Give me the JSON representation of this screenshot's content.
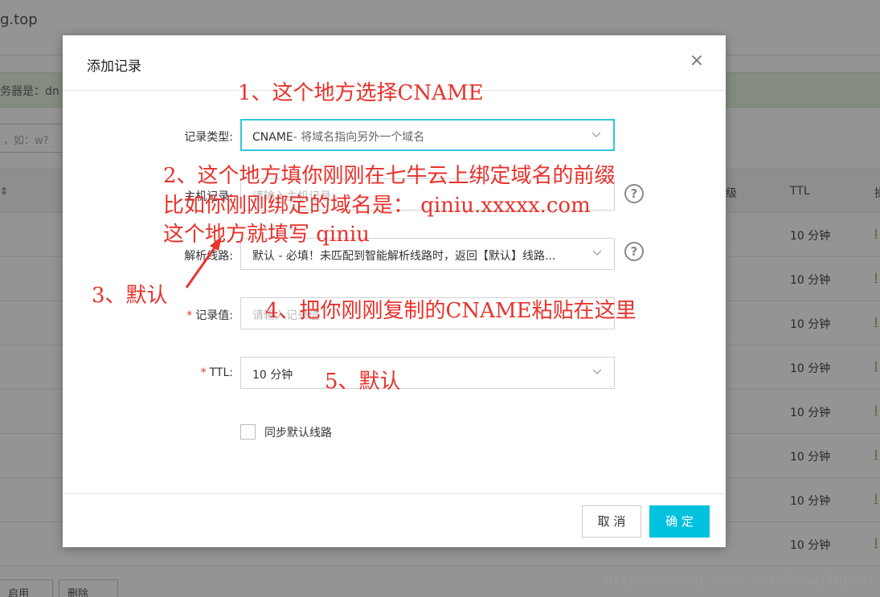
{
  "background": {
    "domain_suffix": "g.top",
    "notice": "务器是：dn",
    "search_placeholder": "，如：w?",
    "col_level": "级",
    "col_ttl": "TTL",
    "col_op": "操",
    "rows": [
      "10 分钟",
      "10 分钟",
      "10 分钟",
      "10 分钟",
      "10 分钟",
      "10 分钟",
      "10 分钟",
      "10 分钟"
    ],
    "row_op": "I",
    "btn_enable": "启用",
    "btn_delete": "删除"
  },
  "dialog": {
    "title": "添加记录",
    "fields": {
      "record_type": {
        "label": "记录类型:",
        "value": "CNAME",
        "hint": "- 将域名指向另外一个域名"
      },
      "host_record": {
        "label": "主机记录:",
        "placeholder": "请输入主机记录"
      },
      "line": {
        "label": "解析线路:",
        "value": "默认 - 必填！未匹配到智能解析线路时，返回【默认】线路..."
      },
      "record_value": {
        "label": "记录值:",
        "placeholder": "请输入记录值"
      },
      "ttl": {
        "label": "TTL:",
        "value": "10 分钟"
      }
    },
    "sync_default_line": "同步默认线路",
    "cancel": "取 消",
    "confirm": "确 定"
  },
  "annotations": {
    "step1": "1、这个地方选择CNAME",
    "step2_line1": "2、这个地方填你刚刚在七牛云上绑定域名的前缀",
    "step2_line2": "比如你刚刚绑定的域名是：  qiniu.xxxxx.com",
    "step2_line3": "这个地方就填写    qiniu",
    "step3": "3、默认",
    "step4": "4、把你刚刚复制的CNAME粘贴在这里",
    "step5": "5、默认"
  },
  "watermark": "https://blog.csdn.net/Tomwildboar",
  "colors": {
    "primary": "#00c1de",
    "focus_border": "#2ec7dc",
    "annotation": "#e8322c",
    "required": "#e0302a"
  }
}
